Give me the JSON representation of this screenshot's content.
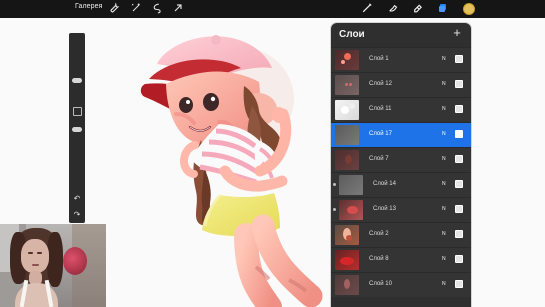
{
  "topbar": {
    "gallery_label": "Галерея",
    "color_swatch": "#e3c15d"
  },
  "layers_panel": {
    "title": "Слои",
    "add_label": "+",
    "items": [
      {
        "label": "Слой 1",
        "mode": "N",
        "active": false,
        "indented": false
      },
      {
        "label": "Слой 12",
        "mode": "N",
        "active": false,
        "indented": false
      },
      {
        "label": "Слой 11",
        "mode": "N",
        "active": false,
        "indented": false
      },
      {
        "label": "Слой 17",
        "mode": "N",
        "active": true,
        "indented": false
      },
      {
        "label": "Слой 7",
        "mode": "N",
        "active": false,
        "indented": false
      },
      {
        "label": "Слой 14",
        "mode": "N",
        "active": false,
        "indented": true
      },
      {
        "label": "Слой 13",
        "mode": "N",
        "active": false,
        "indented": true
      },
      {
        "label": "Слой 2",
        "mode": "N",
        "active": false,
        "indented": false
      },
      {
        "label": "Слой 8",
        "mode": "N",
        "active": false,
        "indented": false
      },
      {
        "label": "Слой 10",
        "mode": "N",
        "active": false,
        "indented": false
      }
    ]
  },
  "colors": {
    "accent": "#1e73e8",
    "panel": "#2f2f2f",
    "toolbar": "#151515"
  },
  "icons": {
    "actions": "wrench-icon",
    "adjustments": "wand-icon",
    "selection": "selection-icon",
    "transform": "arrow-icon",
    "brush": "brush-icon",
    "smudge": "smudge-icon",
    "eraser": "eraser-icon",
    "layers": "layers-icon"
  }
}
